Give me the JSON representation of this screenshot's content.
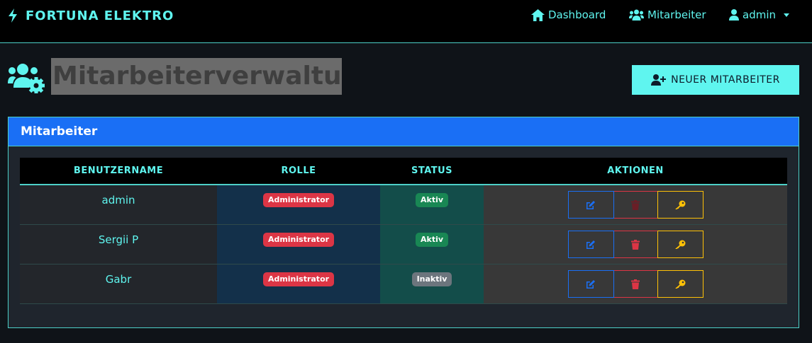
{
  "navbar": {
    "brand": "FORTUNA ELEKTRO",
    "links": [
      {
        "label": "Dashboard",
        "icon": "home-icon"
      },
      {
        "label": "Mitarbeiter",
        "icon": "users-icon"
      },
      {
        "label": "admin",
        "icon": "user-icon"
      }
    ]
  },
  "page": {
    "title": "Mitarbeiterverwaltung",
    "icon": "users-gear-icon",
    "new_button": "NEUER MITARBEITER"
  },
  "card": {
    "title": "Mitarbeiter",
    "columns": [
      "BENUTZERNAME",
      "ROLLE",
      "STATUS",
      "AKTIONEN"
    ],
    "rows": [
      {
        "username": "admin",
        "role": "Administrator",
        "status": "Aktiv"
      },
      {
        "username": "Sergii P",
        "role": "Administrator",
        "status": "Aktiv"
      },
      {
        "username": "Gabr",
        "role": "Administrator",
        "status": "Inaktiv"
      }
    ]
  },
  "colors": {
    "accent": "#5ff5ef",
    "primary": "#1a6ff5",
    "danger": "#dc3545",
    "success": "#198754",
    "secondary": "#6c757d",
    "warning": "#ffc107"
  }
}
